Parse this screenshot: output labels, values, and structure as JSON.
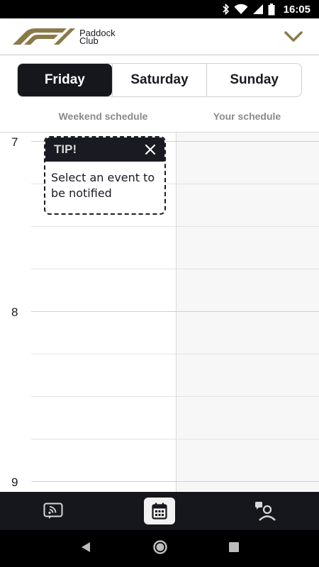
{
  "status_bar": {
    "time": "16:05",
    "icons": [
      "bluetooth-icon",
      "wifi-icon",
      "signal-icon",
      "battery-icon"
    ]
  },
  "header": {
    "logo_text_line1": "Paddock",
    "logo_text_line2": "Club",
    "menu_icon": "chevron-down-icon",
    "accent_color": "#8a7a4a"
  },
  "tabs": [
    {
      "label": "Friday",
      "selected": true
    },
    {
      "label": "Saturday",
      "selected": false
    },
    {
      "label": "Sunday",
      "selected": false
    }
  ],
  "columns": {
    "weekend": "Weekend schedule",
    "yours": "Your schedule"
  },
  "hours": [
    "7",
    "8",
    "9"
  ],
  "tip": {
    "title": "TIP!",
    "message": "Select an event to be notified",
    "close_icon": "close-icon"
  },
  "bottom_nav": [
    {
      "icon": "live-feed-icon",
      "active": false
    },
    {
      "icon": "calendar-icon",
      "active": true
    },
    {
      "icon": "contact-person-icon",
      "active": false
    }
  ],
  "system_nav": [
    "back-icon",
    "home-icon",
    "recents-icon"
  ]
}
